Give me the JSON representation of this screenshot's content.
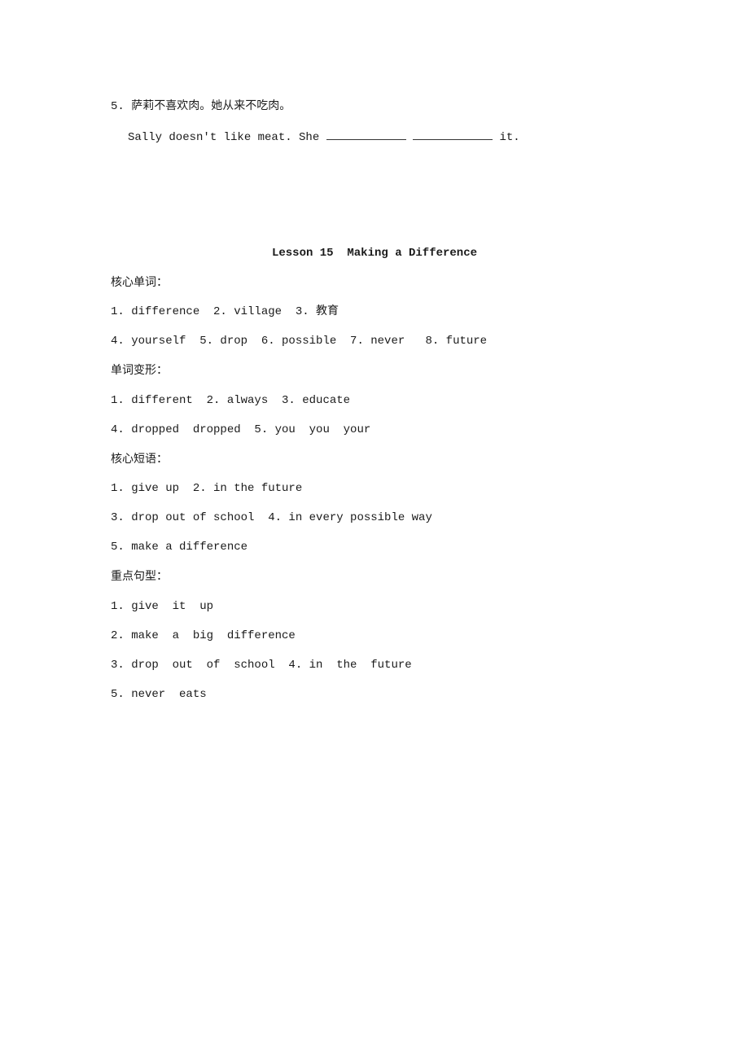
{
  "exercise": {
    "number": "5.",
    "chinese": "萨莉不喜欢肉。她从来不吃肉。",
    "english_before": "Sally doesn't like meat. She",
    "english_after": "it."
  },
  "lesson": {
    "title": "Lesson 15  Making a Difference",
    "sections": [
      {
        "heading": "核心单词：",
        "lines": [
          "1. difference  2. village  3. 教育",
          "4. yourself  5. drop  6. possible  7. never   8. future"
        ]
      },
      {
        "heading": "单词变形：",
        "lines": [
          "1. different  2. always  3. educate",
          "4. dropped  dropped  5. you  you  your"
        ]
      },
      {
        "heading": "核心短语：",
        "lines": [
          "1. give up  2. in the future",
          "3. drop out of school  4. in every possible way",
          "5. make a difference"
        ]
      },
      {
        "heading": "重点句型：",
        "lines": [
          "1. give  it  up",
          "2. make  a  big  difference",
          "3. drop  out  of  school  4. in  the  future",
          "5. never  eats"
        ]
      }
    ]
  }
}
